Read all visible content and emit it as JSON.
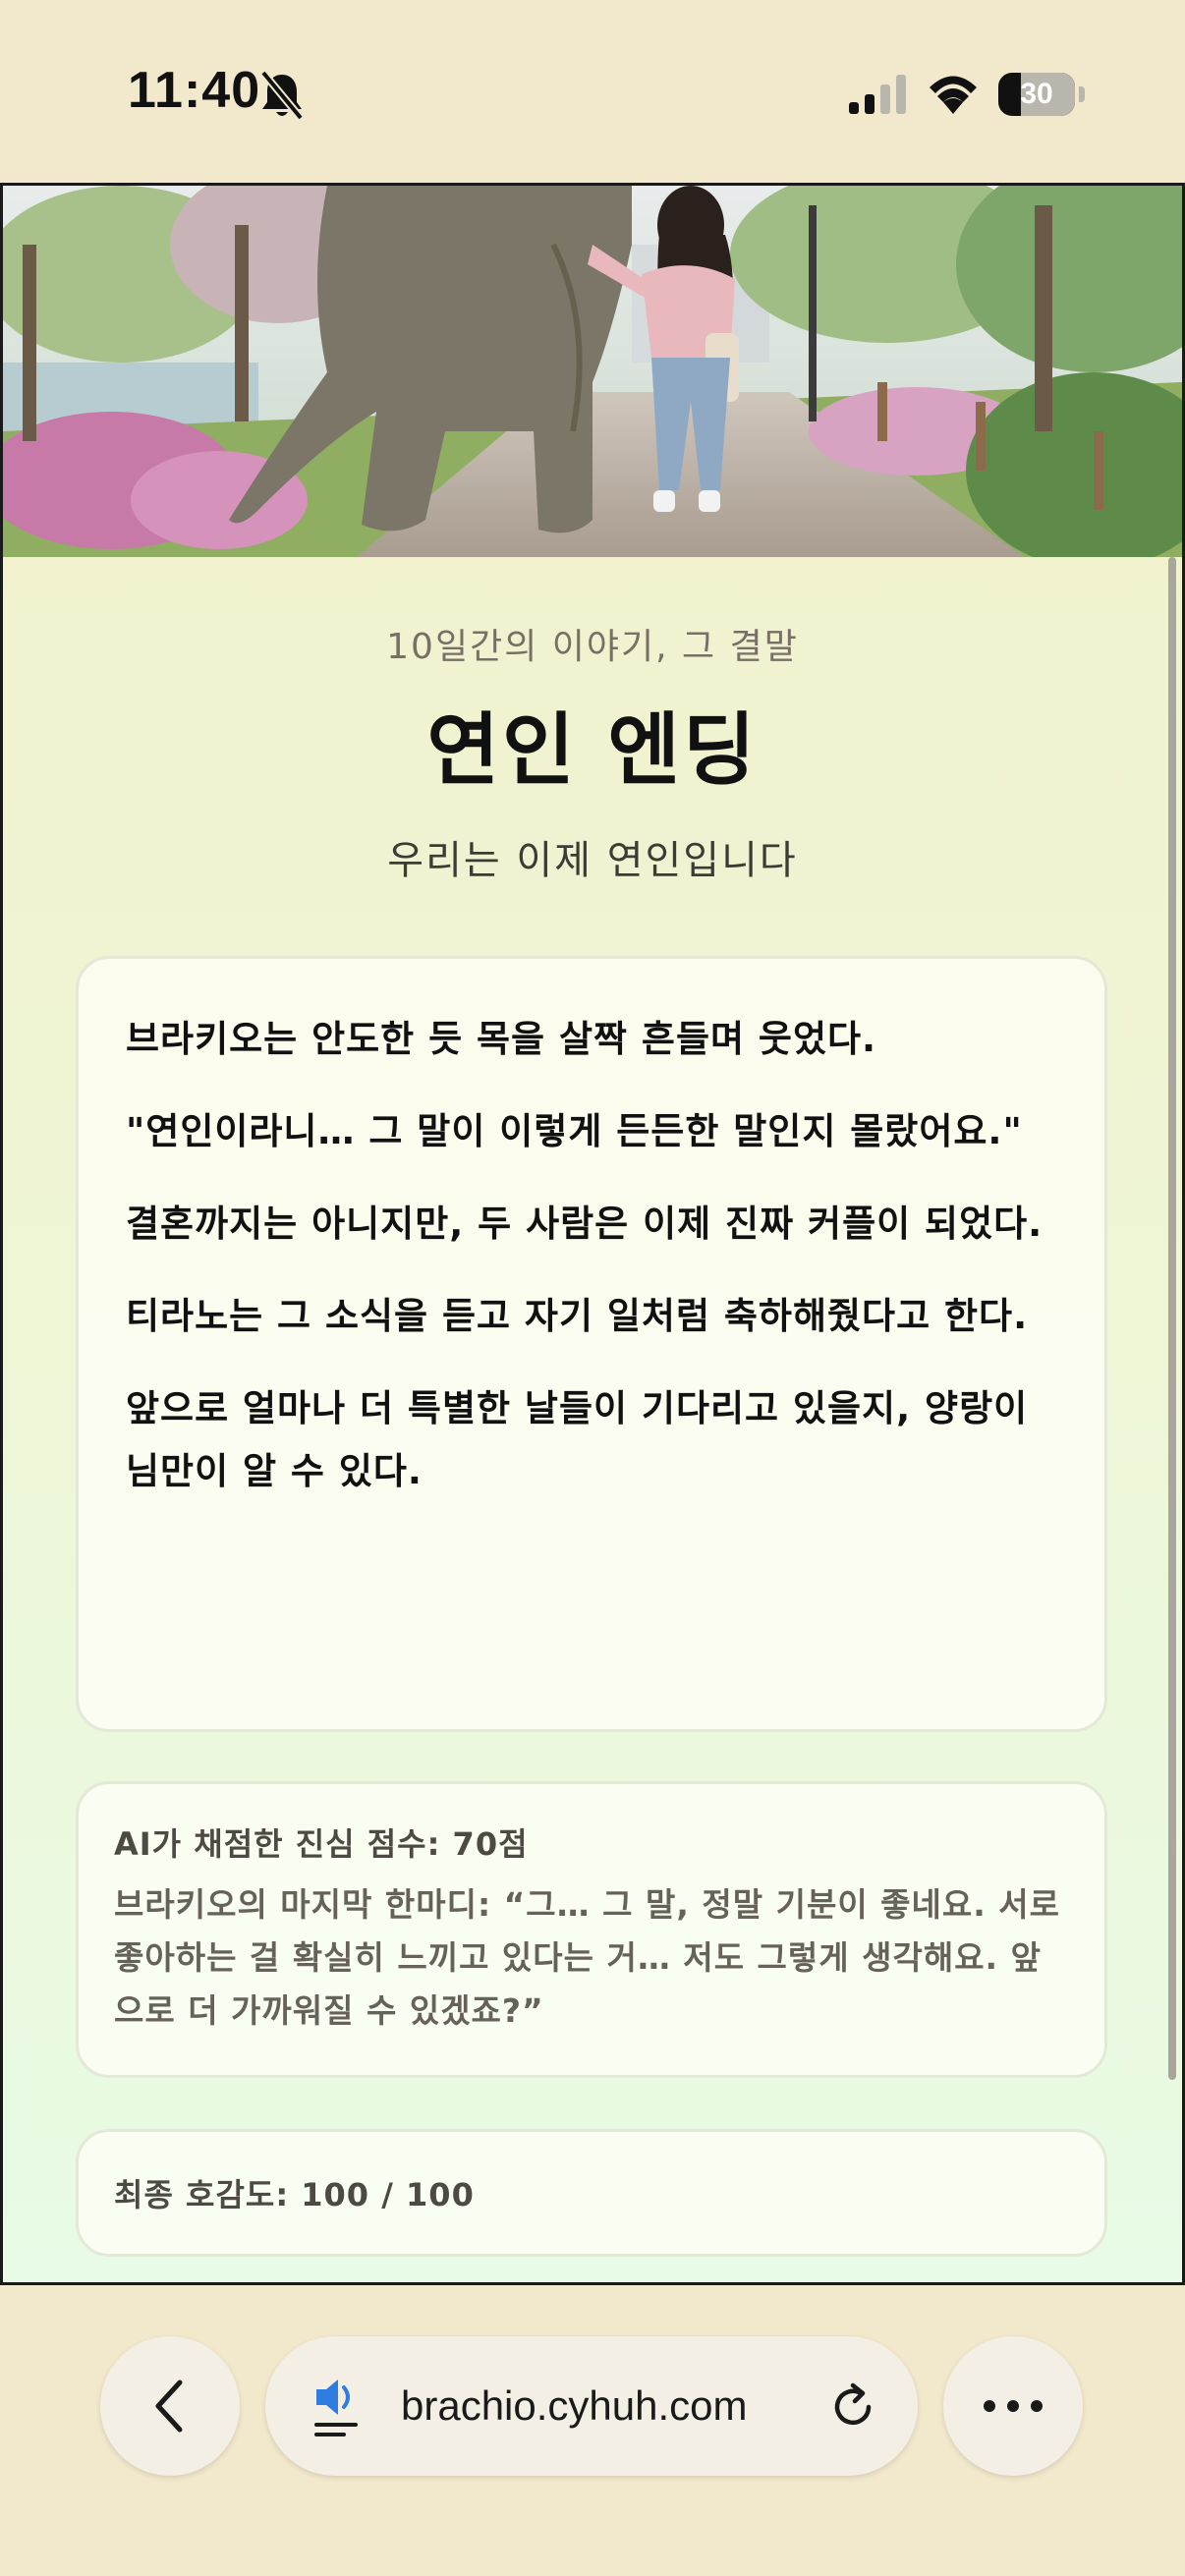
{
  "status_bar": {
    "time": "11:40",
    "battery_percent": "30",
    "battery_level": 0.3,
    "icons": [
      "bell-slash-icon",
      "cellular-signal-icon",
      "wifi-icon",
      "battery-icon"
    ]
  },
  "page": {
    "hero_image": "woman-walking-with-elephant-in-park",
    "subtitle": "10일간의 이야기, 그 결말",
    "title": "연인 엔딩",
    "tagline": "우리는 이제 연인입니다",
    "story_paragraphs": [
      "브라키오는 안도한 듯 목을 살짝 흔들며 웃었다.",
      "\"연인이라니… 그 말이 이렇게 든든한 말인지 몰랐어요.\"",
      "결혼까지는 아니지만, 두 사람은 이제 진짜 커플이 되었다.",
      "티라노는 그 소식을 듣고 자기 일처럼 축하해줬다고 한다.",
      "앞으로 얼마나 더 특별한 날들이 기다리고 있을지, 양랑이님만이 알 수 있다."
    ],
    "score_card": {
      "title": "AI가 채점한 진심 점수: 70점",
      "quote": "브라키오의 마지막 한마디: “그… 그 말, 정말 기분이 좋네요. 서로 좋아하는 걸 확실히 느끼고 있다는 거… 저도 그렇게 생각해요. 앞으로 더 가까워질 수 있겠죠?”"
    },
    "final_affection": "최종 호감도: 100 / 100"
  },
  "browser": {
    "url": "brachio.cyhuh.com",
    "icons": [
      "back-chevron-icon",
      "speaker-icon",
      "reload-icon",
      "more-icon"
    ]
  },
  "colors": {
    "background": "#f2e8cc",
    "title_text": "#111111",
    "muted_text": "#777066"
  }
}
